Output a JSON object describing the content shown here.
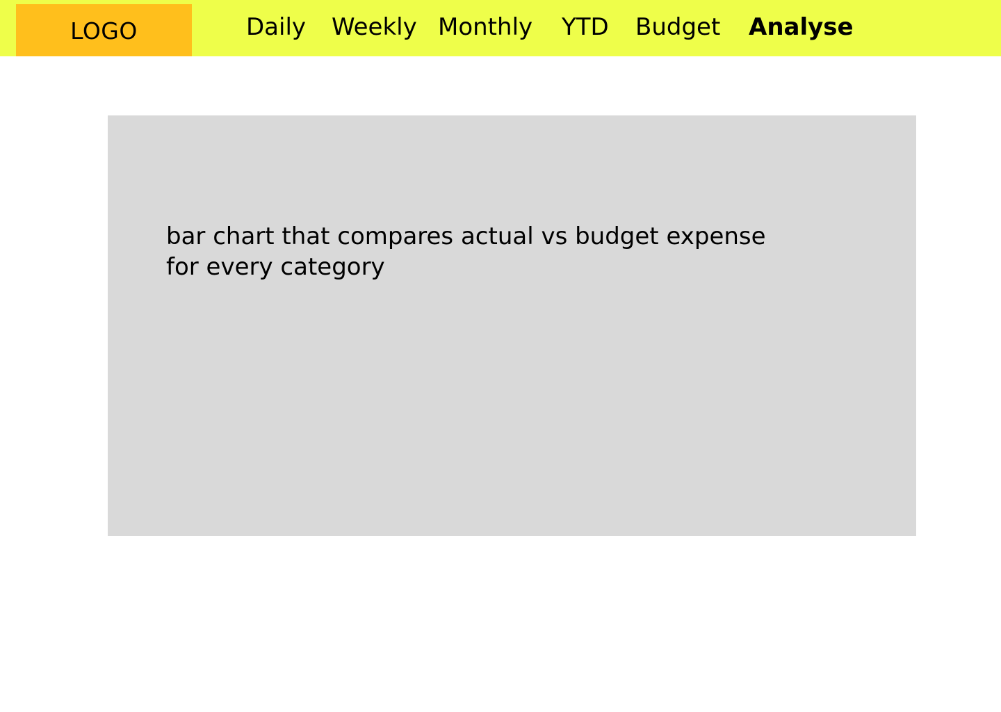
{
  "header": {
    "logo_text": "LOGO",
    "nav": [
      {
        "label": "Daily",
        "active": false
      },
      {
        "label": "Weekly",
        "active": false
      },
      {
        "label": "Monthly",
        "active": false
      },
      {
        "label": "YTD",
        "active": false
      },
      {
        "label": "Budget",
        "active": false
      },
      {
        "label": "Analyse",
        "active": true
      }
    ]
  },
  "main": {
    "chart_placeholder_text": "bar chart that compares actual vs budget expense for every category"
  },
  "colors": {
    "header_bg": "#eefe4a",
    "logo_bg": "#ffbf1c",
    "placeholder_bg": "#d9d9d9"
  }
}
